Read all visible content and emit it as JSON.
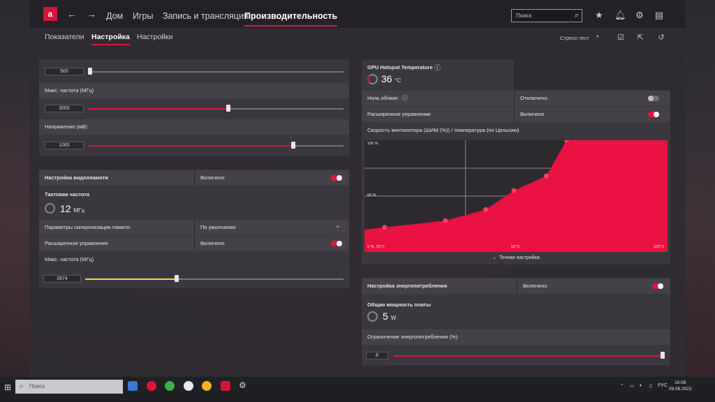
{
  "topbar": {
    "logo": "a",
    "back_icon": "←",
    "forward_icon": "→",
    "nav": [
      "Дом",
      "Игры",
      "Запись и трансляция",
      "Производительность"
    ],
    "search_placeholder": "Поиск"
  },
  "subnav": {
    "tabs": [
      "Показатели",
      "Настройка",
      "Настройки"
    ],
    "stress_test": "Стресс-тест"
  },
  "gpu_panel": {
    "slider1_value": "500",
    "max_freq_label": "Макс. частота (МГц)",
    "max_freq_value": "3000",
    "voltage_label": "Напряжение (мВ)",
    "voltage_value": "1065"
  },
  "vram_panel": {
    "title": "Настройка видеопамяти",
    "title_state": "Включено",
    "clock_label": "Тактовая частота",
    "clock_value": "12",
    "clock_unit": "МГц",
    "timing_label": "Параметры синхронизации памяти",
    "timing_value": "По умолчанию",
    "adv_label": "Расширенное управление",
    "adv_state": "Включено",
    "max_freq_label": "Макс. частота (МГц)",
    "max_freq_value": "2674"
  },
  "fan_panel": {
    "hotspot_label": "GPU Hotspot Temperature",
    "hotspot_value": "36",
    "hotspot_unit": "°C",
    "zero_rpm_label": "Ноль об/мин",
    "zero_rpm_state": "Отключено",
    "adv_label": "Расширенное управление",
    "adv_state": "Включено",
    "curve_label": "Скорость вентилятора (ШИМ (%)) / температура (по Цельсию)",
    "fine_tune": "Точная настройка"
  },
  "chart_data": {
    "type": "area",
    "title": "Скорость вентилятора (ШИМ (%)) / температура (по Цельсию)",
    "x": [
      25,
      30,
      45,
      55,
      62,
      70,
      75,
      100
    ],
    "y": [
      20,
      22,
      28,
      38,
      55,
      68,
      100,
      100
    ],
    "tick_labels": {
      "y_top": "100 %",
      "y_mid": "50 %",
      "x_left": "0 %, 25°C",
      "x_mid": "62°C",
      "x_right": "100°C"
    },
    "xlim": [
      25,
      100
    ],
    "ylim": [
      0,
      100
    ],
    "color": "#e8113f",
    "grid": true
  },
  "power_panel": {
    "title": "Настройка энергопотребления",
    "title_state": "Включено",
    "board_power_label": "Общая мощность платы",
    "board_power_value": "5",
    "board_power_unit": "W",
    "limit_label": "Ограничение энергопотребления (%)",
    "limit_value": "8"
  },
  "taskbar": {
    "search_placeholder": "Поиск",
    "lang": "РУС",
    "time": "16:08",
    "date": "09.08.2023"
  },
  "colors": {
    "accent": "#e0163f",
    "yellow": "#f0d33a"
  }
}
